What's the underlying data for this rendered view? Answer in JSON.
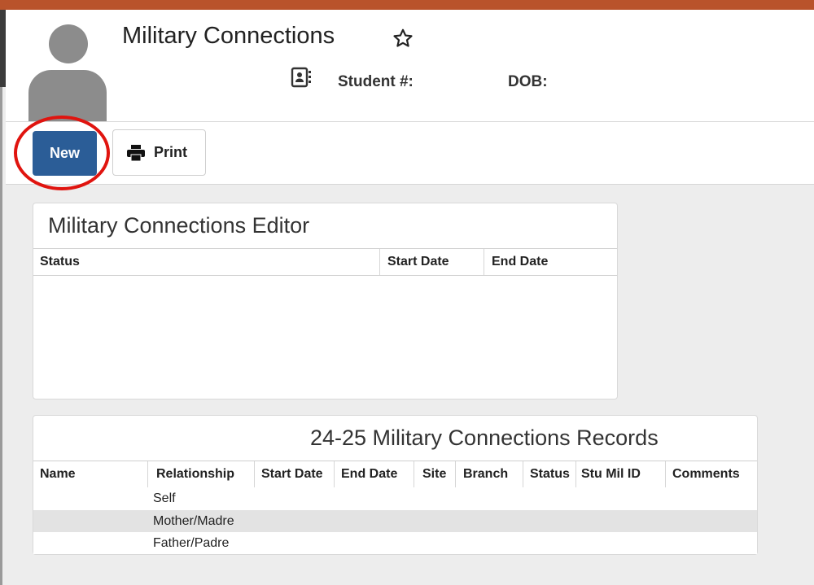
{
  "header": {
    "title": "Military Connections",
    "student_label": "Student #:",
    "dob_label": "DOB:"
  },
  "toolbar": {
    "new_label": "New",
    "print_label": "Print"
  },
  "editor": {
    "title": "Military Connections Editor",
    "columns": [
      "Status",
      "Start Date",
      "End Date"
    ]
  },
  "records": {
    "title": "24-25 Military Connections Records",
    "columns": [
      "Name",
      "Relationship",
      "Start Date",
      "End Date",
      "Site",
      "Branch",
      "Status",
      "Stu Mil ID",
      "Comments"
    ],
    "rows": [
      {
        "relationship": "Self"
      },
      {
        "relationship": "Mother/Madre"
      },
      {
        "relationship": "Father/Padre"
      }
    ]
  },
  "colors": {
    "top_bar": "#b9532b",
    "primary_button": "#2b5d97",
    "highlight_circle": "#e0140f",
    "selected_row": "#e3e3e3"
  }
}
